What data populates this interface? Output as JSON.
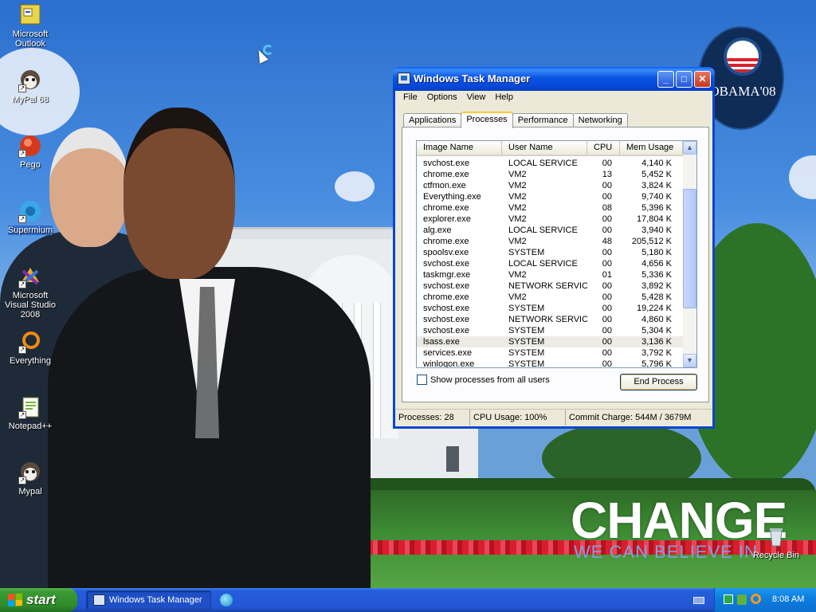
{
  "desktop": {
    "icons": [
      {
        "label": "Microsoft Outlook",
        "icon": "outlook-icon",
        "shortcut": false
      },
      {
        "label": "MyPal 68",
        "icon": "mypal-icon",
        "shortcut": true
      },
      {
        "label": "Pego",
        "icon": "pego-icon",
        "shortcut": true
      },
      {
        "label": "Supermium",
        "icon": "supermium-icon",
        "shortcut": true
      },
      {
        "label": "Microsoft Visual Studio 2008",
        "icon": "visual-studio-icon",
        "shortcut": true
      },
      {
        "label": "Everything",
        "icon": "everything-icon",
        "shortcut": true
      },
      {
        "label": "Notepad++",
        "icon": "notepadpp-icon",
        "shortcut": true
      },
      {
        "label": "Mypal",
        "icon": "mypal-icon",
        "shortcut": true
      }
    ],
    "recycle_bin": "Recycle Bin",
    "wallpaper": {
      "badge_text": "OBAMA'08",
      "headline": "CHANGE",
      "tagline": "WE CAN BELIEVE IN"
    }
  },
  "task_manager": {
    "title": "Windows Task Manager",
    "menu": [
      "File",
      "Options",
      "View",
      "Help"
    ],
    "tabs": [
      "Applications",
      "Processes",
      "Performance",
      "Networking"
    ],
    "active_tab": "Processes",
    "columns": [
      "Image Name",
      "User Name",
      "CPU",
      "Mem Usage"
    ],
    "processes": [
      {
        "name": "svchost.exe",
        "user": "LOCAL SERVICE",
        "cpu": "00",
        "mem": "4,140 K"
      },
      {
        "name": "chrome.exe",
        "user": "VM2",
        "cpu": "13",
        "mem": "5,452 K"
      },
      {
        "name": "ctfmon.exe",
        "user": "VM2",
        "cpu": "00",
        "mem": "3,824 K"
      },
      {
        "name": "Everything.exe",
        "user": "VM2",
        "cpu": "00",
        "mem": "9,740 K"
      },
      {
        "name": "chrome.exe",
        "user": "VM2",
        "cpu": "08",
        "mem": "5,396 K"
      },
      {
        "name": "explorer.exe",
        "user": "VM2",
        "cpu": "00",
        "mem": "17,804 K"
      },
      {
        "name": "alg.exe",
        "user": "LOCAL SERVICE",
        "cpu": "00",
        "mem": "3,940 K"
      },
      {
        "name": "chrome.exe",
        "user": "VM2",
        "cpu": "48",
        "mem": "205,512 K"
      },
      {
        "name": "spoolsv.exe",
        "user": "SYSTEM",
        "cpu": "00",
        "mem": "5,180 K"
      },
      {
        "name": "svchost.exe",
        "user": "LOCAL SERVICE",
        "cpu": "00",
        "mem": "4,656 K"
      },
      {
        "name": "taskmgr.exe",
        "user": "VM2",
        "cpu": "01",
        "mem": "5,336 K"
      },
      {
        "name": "svchost.exe",
        "user": "NETWORK SERVICE",
        "cpu": "00",
        "mem": "3,892 K"
      },
      {
        "name": "chrome.exe",
        "user": "VM2",
        "cpu": "00",
        "mem": "5,428 K"
      },
      {
        "name": "svchost.exe",
        "user": "SYSTEM",
        "cpu": "00",
        "mem": "19,224 K"
      },
      {
        "name": "svchost.exe",
        "user": "NETWORK SERVICE",
        "cpu": "00",
        "mem": "4,860 K"
      },
      {
        "name": "svchost.exe",
        "user": "SYSTEM",
        "cpu": "00",
        "mem": "5,304 K"
      },
      {
        "name": "lsass.exe",
        "user": "SYSTEM",
        "cpu": "00",
        "mem": "3,136 K",
        "selected": true
      },
      {
        "name": "services.exe",
        "user": "SYSTEM",
        "cpu": "00",
        "mem": "3,792 K"
      },
      {
        "name": "winlogon.exe",
        "user": "SYSTEM",
        "cpu": "00",
        "mem": "5,796 K"
      }
    ],
    "show_all_label": "Show processes from all users",
    "show_all_checked": false,
    "end_process_label": "End Process",
    "status": {
      "processes": "Processes: 28",
      "cpu": "CPU Usage: 100%",
      "commit": "Commit Charge: 544M / 3679M"
    }
  },
  "taskbar": {
    "start_label": "start",
    "task_button": "Windows Task Manager",
    "clock": "8:08 AM"
  },
  "colors": {
    "title_blue": "#0b54e4",
    "taskbar_blue": "#245edb",
    "start_green": "#3c9a35",
    "dialog_face": "#ece9d8"
  }
}
